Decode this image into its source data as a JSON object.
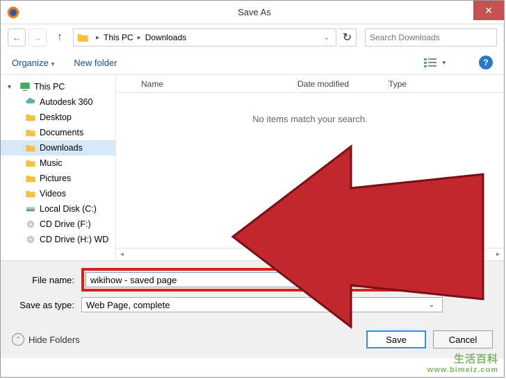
{
  "window": {
    "title": "Save As"
  },
  "nav": {
    "breadcrumb": [
      "This PC",
      "Downloads"
    ],
    "search_placeholder": "Search Downloads"
  },
  "toolbar": {
    "organize": "Organize",
    "new_folder": "New folder"
  },
  "sidebar": {
    "root": "This PC",
    "items": [
      {
        "label": "Autodesk 360",
        "icon": "cloud"
      },
      {
        "label": "Desktop",
        "icon": "folder"
      },
      {
        "label": "Documents",
        "icon": "folder"
      },
      {
        "label": "Downloads",
        "icon": "folder",
        "selected": true
      },
      {
        "label": "Music",
        "icon": "folder"
      },
      {
        "label": "Pictures",
        "icon": "folder"
      },
      {
        "label": "Videos",
        "icon": "folder"
      },
      {
        "label": "Local Disk (C:)",
        "icon": "disk"
      },
      {
        "label": "CD Drive (F:)",
        "icon": "cd"
      },
      {
        "label": "CD Drive (H:) WD",
        "icon": "cd"
      }
    ]
  },
  "columns": {
    "name": "Name",
    "date": "Date modified",
    "type": "Type"
  },
  "list": {
    "empty": "No items match your search."
  },
  "fields": {
    "filename_label": "File name:",
    "filename_value": "wikihow - saved page",
    "type_label": "Save as type:",
    "type_value": "Web Page, complete"
  },
  "footer": {
    "hide_folders": "Hide Folders",
    "save": "Save",
    "cancel": "Cancel"
  },
  "watermark": {
    "main": "生活百科",
    "sub": "www.bimeiz.com"
  }
}
